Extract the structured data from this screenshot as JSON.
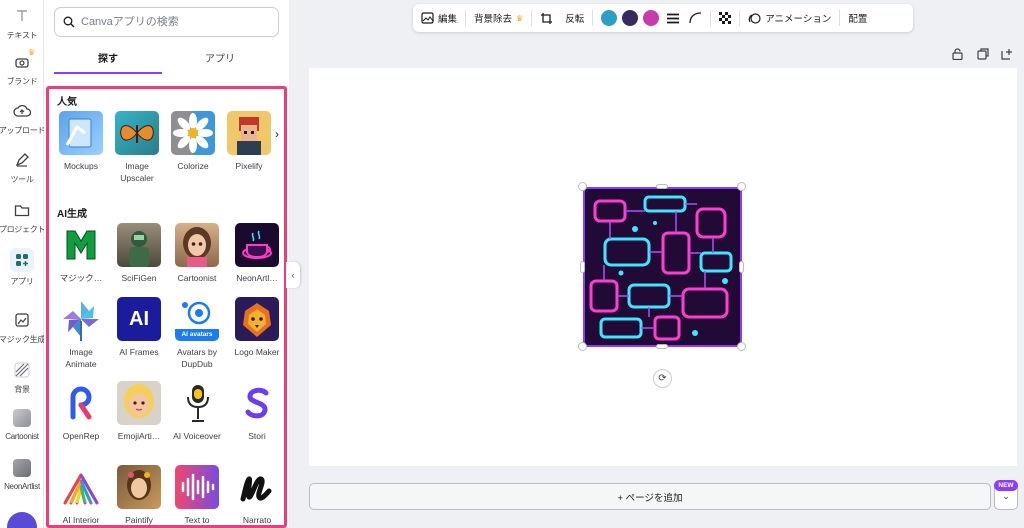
{
  "rail": {
    "text": "テキスト",
    "brand": "ブランド",
    "upload": "アップロード",
    "tools": "ツール",
    "projects": "プロジェクト",
    "apps": "アプリ",
    "magic": "マジック生成",
    "background": "背景",
    "cartoonist": "Cartoonist",
    "neonartlist": "NeonArtlist"
  },
  "panel": {
    "search_placeholder": "Canvaアプリの検索",
    "tab_discover": "探す",
    "tab_apps": "アプリ",
    "popular_title": "人気",
    "ai_title": "AI生成",
    "popular": [
      "Mockups",
      "Image Upscaler",
      "Colorize",
      "Pixelify"
    ],
    "ai": [
      "マジック…",
      "SciFiGen",
      "Cartoonist",
      "NeonArtl…",
      "Image Animate",
      "AI Frames",
      "Avatars by DupDub",
      "Logo Maker",
      "OpenRep",
      "EmojiArti…",
      "AI Voiceover",
      "Stori",
      "AI Interior",
      "Paintify",
      "Text to",
      "Narrato"
    ],
    "ai_frames_logo": "AI",
    "avatars_badge": "AI avatars"
  },
  "toolbar": {
    "edit": "編集",
    "remove_bg": "背景除去",
    "flip": "反転",
    "animate": "アニメーション",
    "position": "配置",
    "colors": [
      "#2b9fc4",
      "#3a2b5f",
      "#c73ca8"
    ]
  },
  "canvas": {
    "add_page": "+ ページを追加",
    "new_badge": "NEW"
  }
}
